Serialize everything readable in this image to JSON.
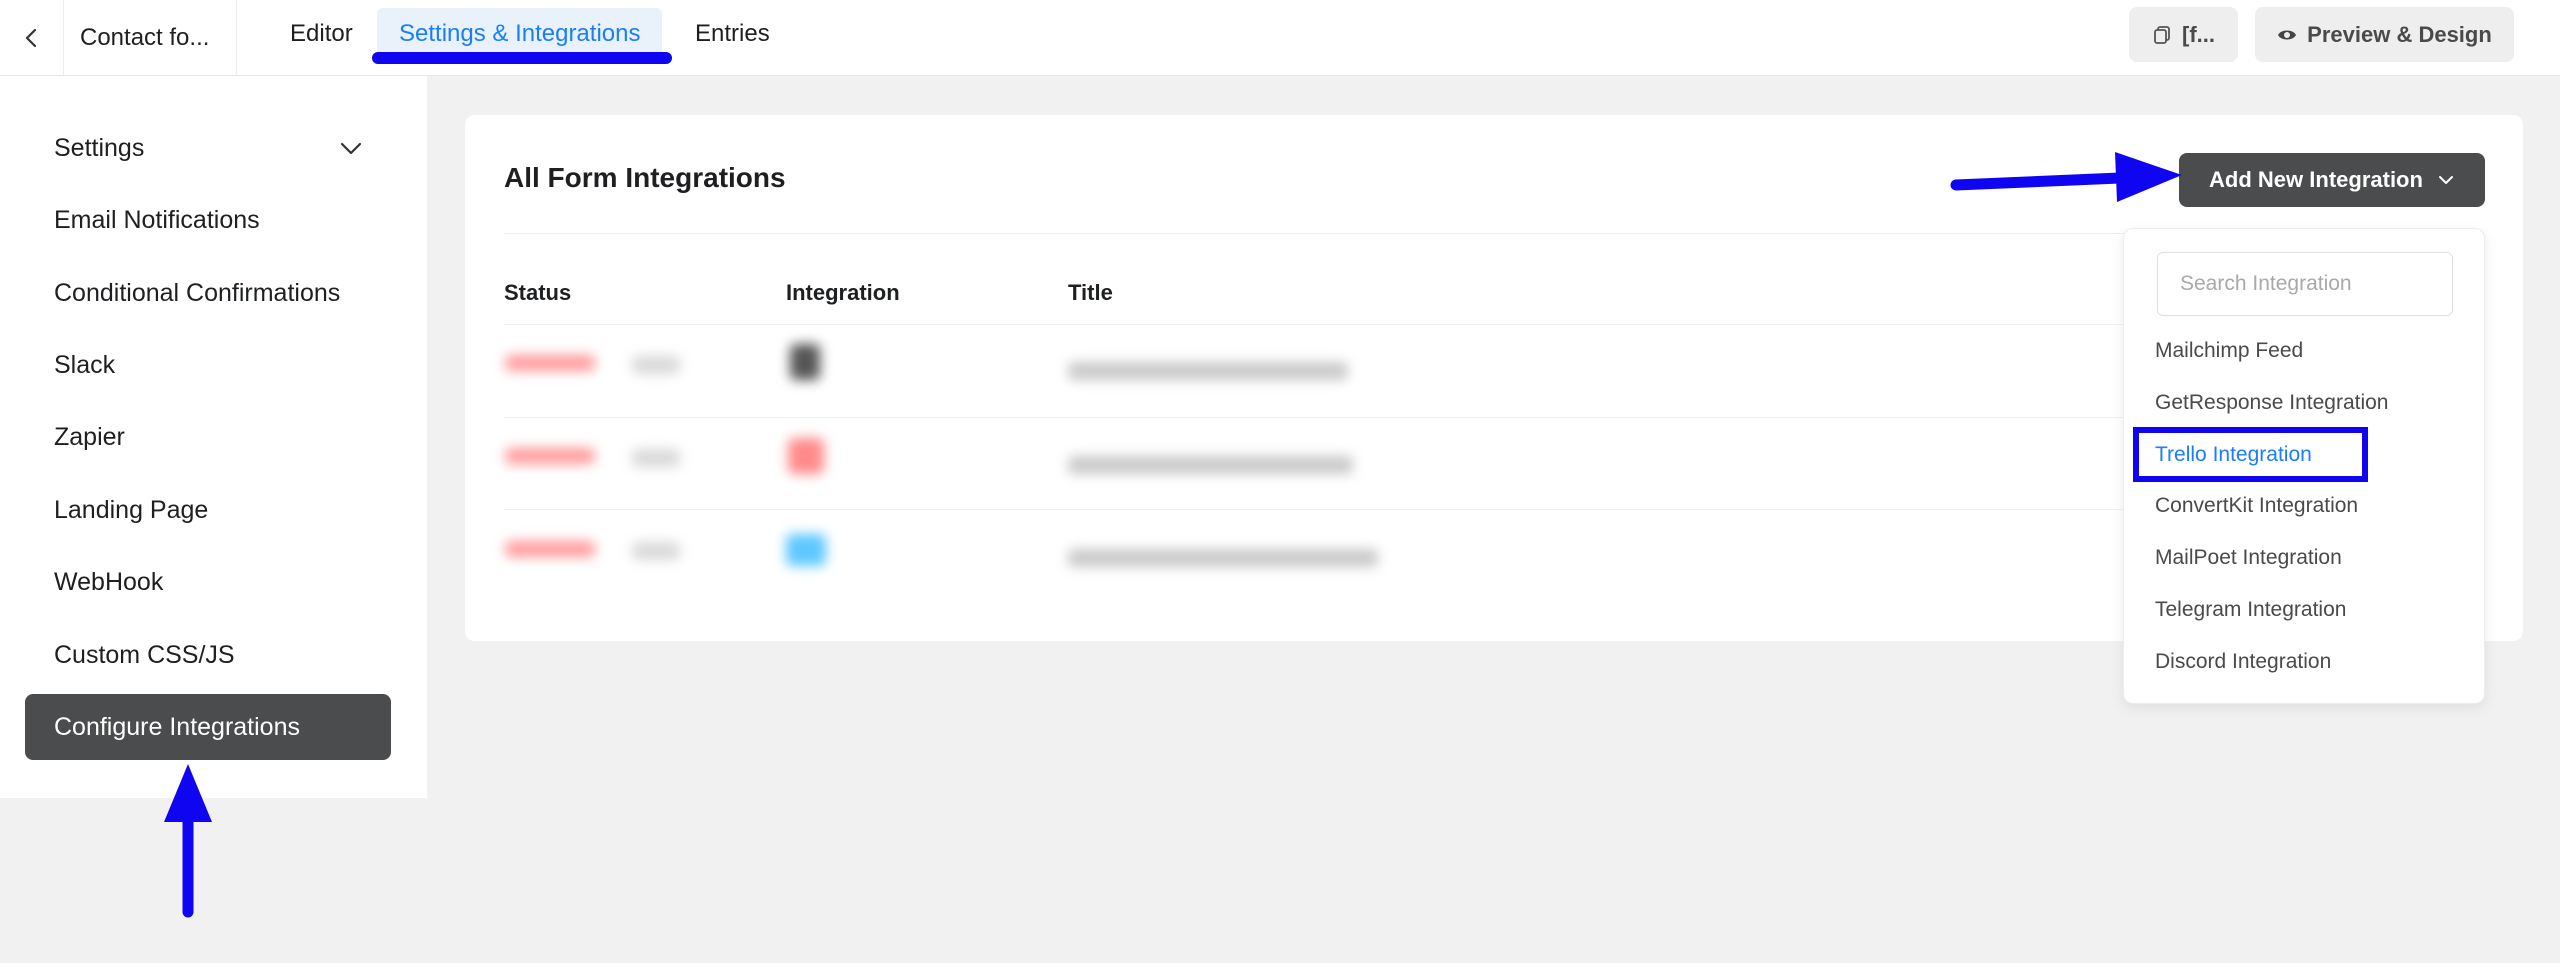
{
  "topbar": {
    "form_name": "Contact fo...",
    "tabs": [
      {
        "label": "Editor"
      },
      {
        "label": "Settings & Integrations"
      },
      {
        "label": "Entries"
      }
    ],
    "shortcode_label": "[f...",
    "preview_label": "Preview & Design"
  },
  "sidebar": {
    "items": [
      {
        "label": "Settings"
      },
      {
        "label": "Email Notifications"
      },
      {
        "label": "Conditional Confirmations"
      },
      {
        "label": "Slack"
      },
      {
        "label": "Zapier"
      },
      {
        "label": "Landing Page"
      },
      {
        "label": "WebHook"
      },
      {
        "label": "Custom CSS/JS"
      },
      {
        "label": "Configure Integrations"
      }
    ]
  },
  "main": {
    "title": "All Form Integrations",
    "add_button_label": "Add New Integration",
    "columns": [
      "Status",
      "Integration",
      "Title"
    ]
  },
  "dropdown": {
    "search_placeholder": "Search Integration",
    "items": [
      {
        "label": "Mailchimp Feed"
      },
      {
        "label": "GetResponse Integration"
      },
      {
        "label": "Trello Integration"
      },
      {
        "label": "ConvertKit Integration"
      },
      {
        "label": "MailPoet Integration"
      },
      {
        "label": "Telegram Integration"
      },
      {
        "label": "Discord Integration"
      }
    ]
  },
  "colors": {
    "accent": "#1a7efb",
    "annotation": "#1005f0",
    "dark_button": "#4b4c4d"
  }
}
